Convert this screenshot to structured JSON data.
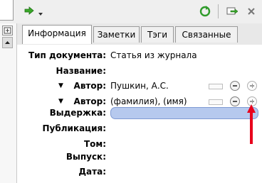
{
  "toolbar": {
    "arrow_icon": "green-arrow-right-icon",
    "dropdown_icon": "dropdown-triangle-icon",
    "refresh_icon": "green-refresh-icon",
    "export_icon": "export-icon",
    "close_icon": "close-icon"
  },
  "tabs": [
    {
      "label": "Информация"
    },
    {
      "label": "Заметки"
    },
    {
      "label": "Тэги"
    },
    {
      "label": "Связанные"
    }
  ],
  "fields": {
    "doc_type_label": "Тип документа:",
    "doc_type_value": "Статья из журнала",
    "title_label": "Название:",
    "author1_label": "Автор:",
    "author1_value": "Пушкин, А.С.",
    "author2_label": "Автор:",
    "author2_value": "(фамилия), (имя)",
    "excerpt_label": "Выдержка:",
    "publication_label": "Публикация:",
    "volume_label": "Том:",
    "issue_label": "Выпуск:",
    "date_label": "Дата:"
  },
  "colors": {
    "accent_red": "#e8001c",
    "excerpt_fill": "#b6c9ee"
  }
}
